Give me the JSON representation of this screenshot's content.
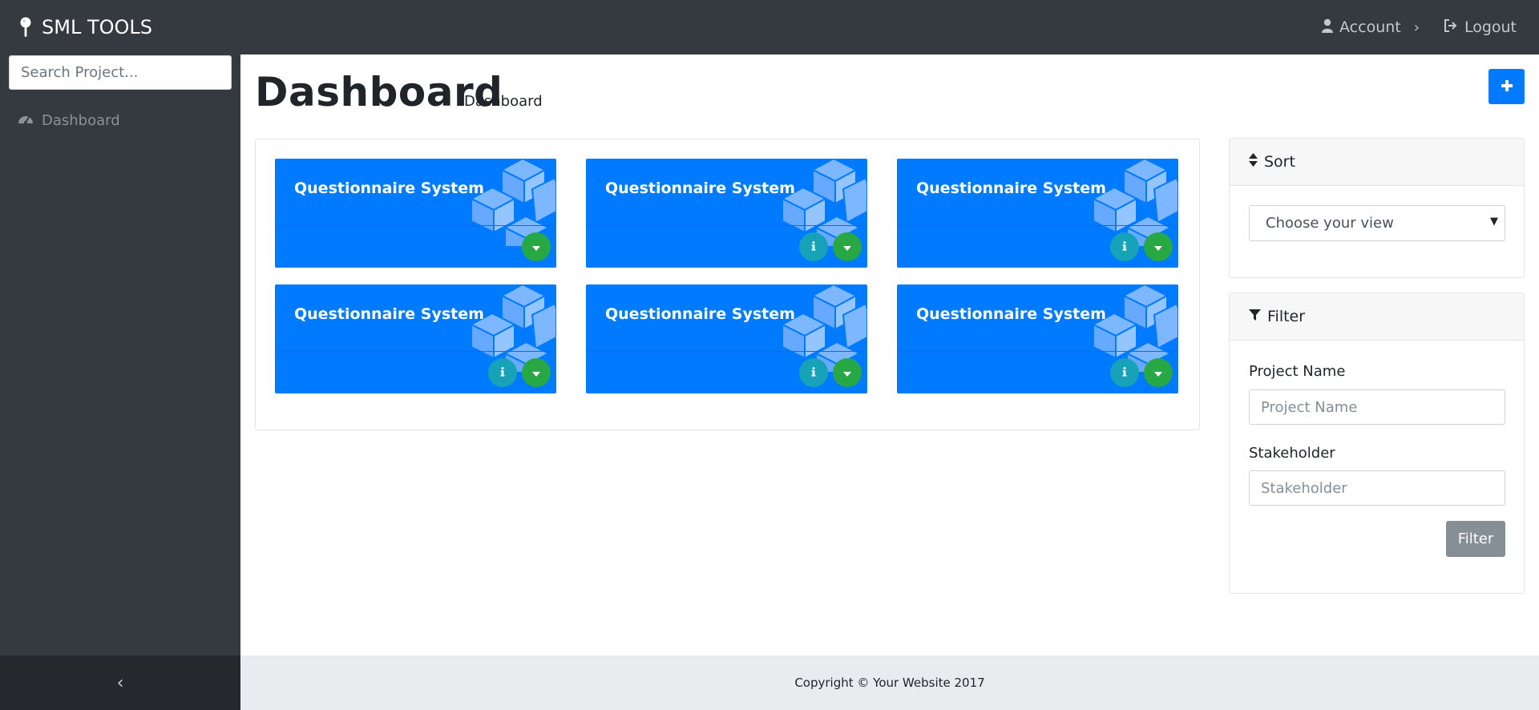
{
  "brand": {
    "name": "SML TOOLS",
    "icon": "map-pin-icon"
  },
  "topnav": {
    "account_label": "Account",
    "account_chevron": "›",
    "logout_label": "Logout"
  },
  "sidebar": {
    "search_placeholder": "Search Project...",
    "items": [
      {
        "label": "Dashboard",
        "icon": "dashboard-gauge-icon"
      }
    ],
    "collapse_label": "‹"
  },
  "page": {
    "title": "Dashboard",
    "breadcrumb": "Dashboard",
    "add_icon": "plus-icon"
  },
  "projects": [
    {
      "title": "Questionnaire System",
      "has_info": false
    },
    {
      "title": "Questionnaire System",
      "has_info": true
    },
    {
      "title": "Questionnaire System",
      "has_info": true
    },
    {
      "title": "Questionnaire System",
      "has_info": true
    },
    {
      "title": "Questionnaire System",
      "has_info": true
    },
    {
      "title": "Questionnaire System",
      "has_info": true
    }
  ],
  "sort": {
    "header": "Sort",
    "select_value": "Choose your view",
    "arrow": "▼"
  },
  "filter": {
    "header": "Filter",
    "project_name_label": "Project Name",
    "project_name_placeholder": "Project Name",
    "stakeholder_label": "Stakeholder",
    "stakeholder_placeholder": "Stakeholder",
    "button_label": "Filter"
  },
  "footer": {
    "text": "Copyright © Your Website 2017"
  },
  "colors": {
    "navbar": "#343a40",
    "primary": "#007bff",
    "info": "#17a2b8",
    "success": "#28a745",
    "secondary": "#868e96"
  }
}
